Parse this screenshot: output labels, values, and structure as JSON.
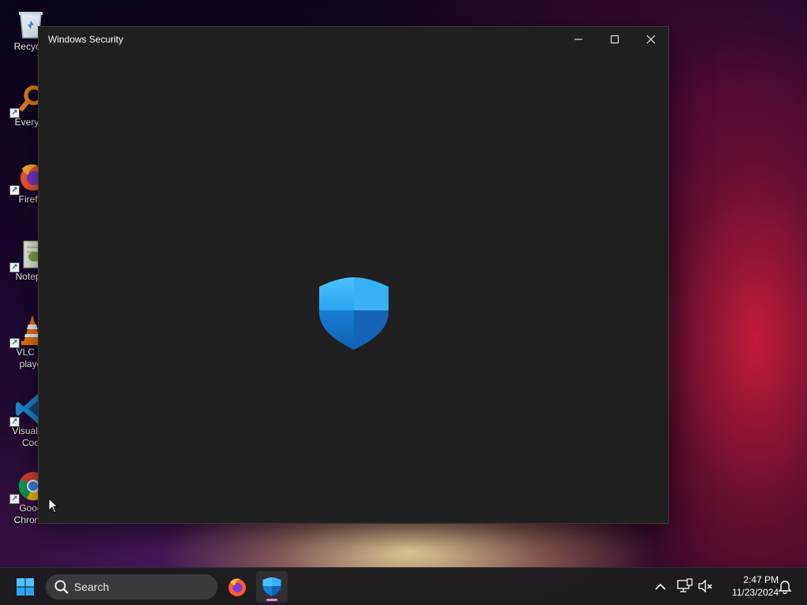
{
  "desktop": {
    "icons": [
      {
        "label": "Recycle",
        "icon": "recycle-bin-icon"
      },
      {
        "label": "Everyth",
        "icon": "everything-search-icon"
      },
      {
        "label": "Firefo",
        "icon": "firefox-icon"
      },
      {
        "label": "Notepa",
        "icon": "notepad-plus-plus-icon"
      },
      {
        "label": "VLC m\nplaye",
        "icon": "vlc-icon"
      },
      {
        "label": "Visual St\nCod",
        "icon": "vscode-icon"
      },
      {
        "label": "Goog\nChrome",
        "icon": "chrome-icon"
      }
    ]
  },
  "window": {
    "title": "Windows Security",
    "controls": [
      "minimize",
      "maximize",
      "close"
    ],
    "content_icon": "windows-security-shield-icon",
    "accent_color": "#1a8be0"
  },
  "taskbar": {
    "search_placeholder": "Search",
    "apps": [
      {
        "name": "Firefox",
        "icon": "firefox-icon",
        "active": false
      },
      {
        "name": "Windows Security",
        "icon": "shield-icon",
        "active": true
      }
    ],
    "clock": {
      "time": "2:47 PM",
      "date": "11/23/2024"
    }
  },
  "colors": {
    "window_bg": "#202020",
    "taskbar_bg": "#1c1c1e",
    "active_indicator": "#e08fd0"
  }
}
